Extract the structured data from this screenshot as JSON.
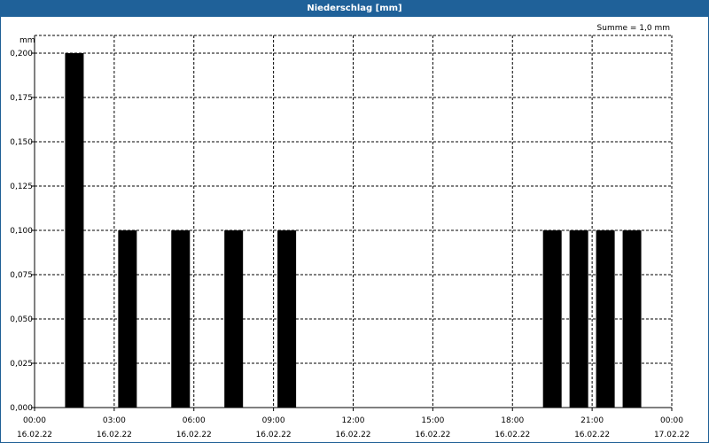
{
  "header": {
    "title": "Niederschlag [mm]"
  },
  "chart_data": {
    "type": "bar",
    "title": "Niederschlag [mm]",
    "ylabel": "mm",
    "annotation": "Summe = 1,0 mm",
    "ylim": [
      0,
      0.2
    ],
    "yticks": [
      {
        "value": 0,
        "label": "0,000"
      },
      {
        "value": 0.025,
        "label": "0,025"
      },
      {
        "value": 0.05,
        "label": "0,050"
      },
      {
        "value": 0.075,
        "label": "0,075"
      },
      {
        "value": 0.1,
        "label": "0,100"
      },
      {
        "value": 0.125,
        "label": "0,125"
      },
      {
        "value": 0.15,
        "label": "0,150"
      },
      {
        "value": 0.175,
        "label": "0,175"
      },
      {
        "value": 0.2,
        "label": "0,200"
      }
    ],
    "xlim_hours": [
      0,
      24
    ],
    "xticks": [
      {
        "hour": 0,
        "time": "00:00",
        "date": "16.02.22"
      },
      {
        "hour": 3,
        "time": "03:00",
        "date": "16.02.22"
      },
      {
        "hour": 6,
        "time": "06:00",
        "date": "16.02.22"
      },
      {
        "hour": 9,
        "time": "09:00",
        "date": "16.02.22"
      },
      {
        "hour": 12,
        "time": "12:00",
        "date": "16.02.22"
      },
      {
        "hour": 15,
        "time": "15:00",
        "date": "16.02.22"
      },
      {
        "hour": 18,
        "time": "18:00",
        "date": "16.02.22"
      },
      {
        "hour": 21,
        "time": "21:00",
        "date": "16.02.22"
      },
      {
        "hour": 24,
        "time": "00:00",
        "date": "17.02.22"
      }
    ],
    "bars": [
      {
        "hour": 1.5,
        "value": 0.2
      },
      {
        "hour": 3.5,
        "value": 0.1
      },
      {
        "hour": 5.5,
        "value": 0.1
      },
      {
        "hour": 7.5,
        "value": 0.1
      },
      {
        "hour": 9.5,
        "value": 0.1
      },
      {
        "hour": 19.5,
        "value": 0.1
      },
      {
        "hour": 20.5,
        "value": 0.1
      },
      {
        "hour": 21.5,
        "value": 0.1
      },
      {
        "hour": 22.5,
        "value": 0.1
      }
    ],
    "grid": true,
    "colors": {
      "bar": "#000000",
      "title_bar": "#1f6199",
      "grid": "#000000"
    }
  }
}
